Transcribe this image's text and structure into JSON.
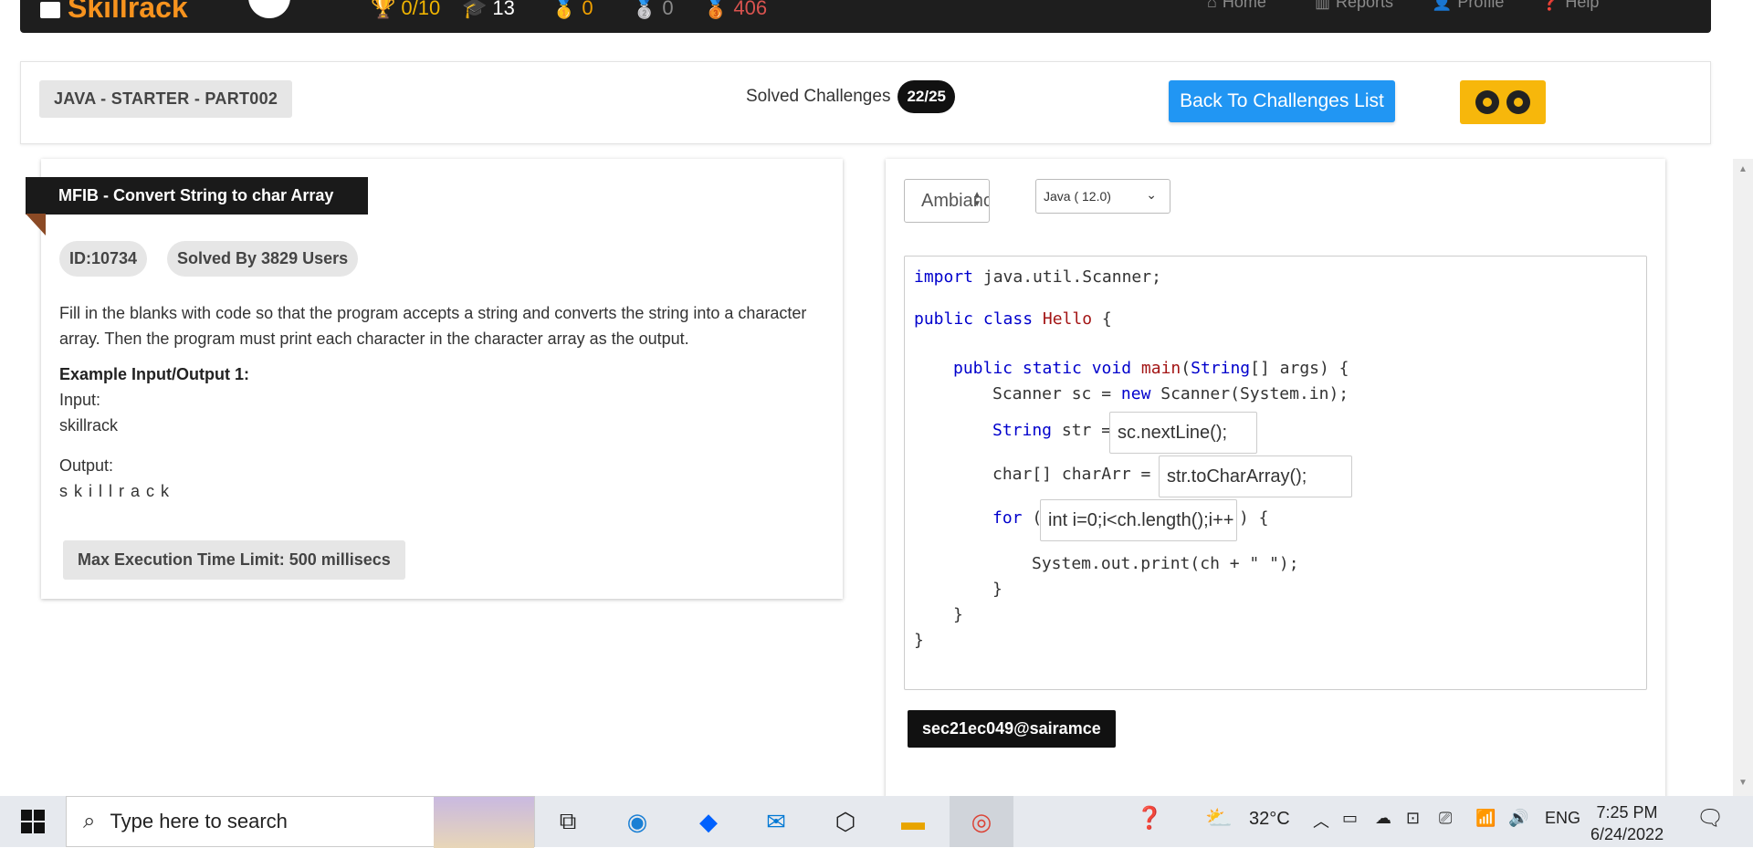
{
  "topnav": {
    "logo": "Skillrack",
    "stats": [
      {
        "icon": "trophy-icon",
        "value": "0/10",
        "color": "#f0b400"
      },
      {
        "icon": "graduation-cap-icon",
        "value": "13",
        "color": "#ffffff"
      },
      {
        "icon": "gold-medal-icon",
        "value": "0",
        "color": "#f0a000"
      },
      {
        "icon": "silver-medal-icon",
        "value": "0",
        "color": "#8a8a8a"
      },
      {
        "icon": "bronze-medal-icon",
        "value": "406",
        "color": "#d9534f"
      }
    ],
    "links": [
      "Home",
      "Reports",
      "Profile",
      "Help"
    ]
  },
  "header": {
    "course": "JAVA - STARTER - PART002",
    "solved_label": "Solved Challenges",
    "solved_count": "22/25",
    "back_button": "Back To Challenges List"
  },
  "problem": {
    "title": "MFIB - Convert String to char Array",
    "id": "ID:10734",
    "solved_by": "Solved By 3829 Users",
    "description": "Fill in the blanks with code so that the program accepts a string and converts the string into a character array. Then the program must print each character in the character array as the output.",
    "example_label": "Example Input/Output 1:",
    "input_label": "Input:",
    "input_value": "skillrack",
    "output_label": "Output:",
    "output_value": "s k i l l r a c k",
    "time_limit": "Max Execution Time Limit: 500 millisecs"
  },
  "editor": {
    "theme": "Ambiance",
    "language": "Java ( 12.0)",
    "code": {
      "l1a": "import",
      "l1b": " java.util.Scanner;",
      "l2a": "public class",
      "l2b": " Hello",
      "l2c": " {",
      "l3a": "public static void",
      "l3b": " main",
      "l3c": "(",
      "l3d": "String",
      "l3e": "[] args) {",
      "l4a": "Scanner sc = ",
      "l4b": "new",
      "l4c": " Scanner(System.in);",
      "l5a": "String",
      "l5b": " str = ",
      "l6": "char[] charArr = ",
      "l7a": "for",
      "l7b": " (",
      "l7c": ") {",
      "l8": "System.out.print(ch + \" \");",
      "l9": "}",
      "l10": "}",
      "l11": "}"
    },
    "blanks": [
      "sc.nextLine();",
      "str.toCharArray();",
      "int i=0;i<ch.length();i++"
    ],
    "user": "sec21ec049@sairamce"
  },
  "taskbar": {
    "search_placeholder": "Type here to search",
    "temperature": "32°C",
    "language": "ENG",
    "time": "7:25 PM",
    "date": "6/24/2022"
  }
}
